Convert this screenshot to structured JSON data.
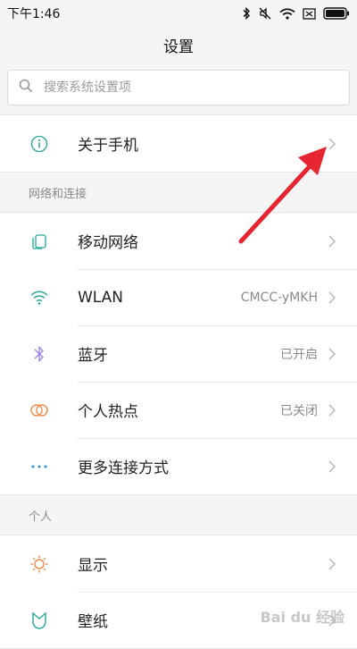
{
  "status_bar": {
    "time": "下午1:46"
  },
  "header": {
    "title": "设置"
  },
  "search": {
    "placeholder": "搜索系统设置项"
  },
  "about": {
    "label": "关于手机"
  },
  "network_section": {
    "title": "网络和连接",
    "items": [
      {
        "label": "移动网络",
        "value": "",
        "icon": "sim-card-icon"
      },
      {
        "label": "WLAN",
        "value": "CMCC-yMKH",
        "icon": "wifi-icon"
      },
      {
        "label": "蓝牙",
        "value": "已开启",
        "icon": "bluetooth-icon"
      },
      {
        "label": "个人热点",
        "value": "已关闭",
        "icon": "hotspot-icon"
      },
      {
        "label": "更多连接方式",
        "value": "",
        "icon": "more-dots-icon"
      }
    ]
  },
  "personal_section": {
    "title": "个人",
    "items": [
      {
        "label": "显示",
        "icon": "brightness-icon"
      },
      {
        "label": "壁纸",
        "icon": "wallpaper-icon"
      }
    ]
  },
  "colors": {
    "accent_teal": "#26a69a",
    "bluetooth_purple": "#9c7cf0",
    "hotspot_orange": "#f08a4b",
    "annotation_red": "#e52630"
  },
  "watermark": {
    "text": "Bai du 经验"
  }
}
